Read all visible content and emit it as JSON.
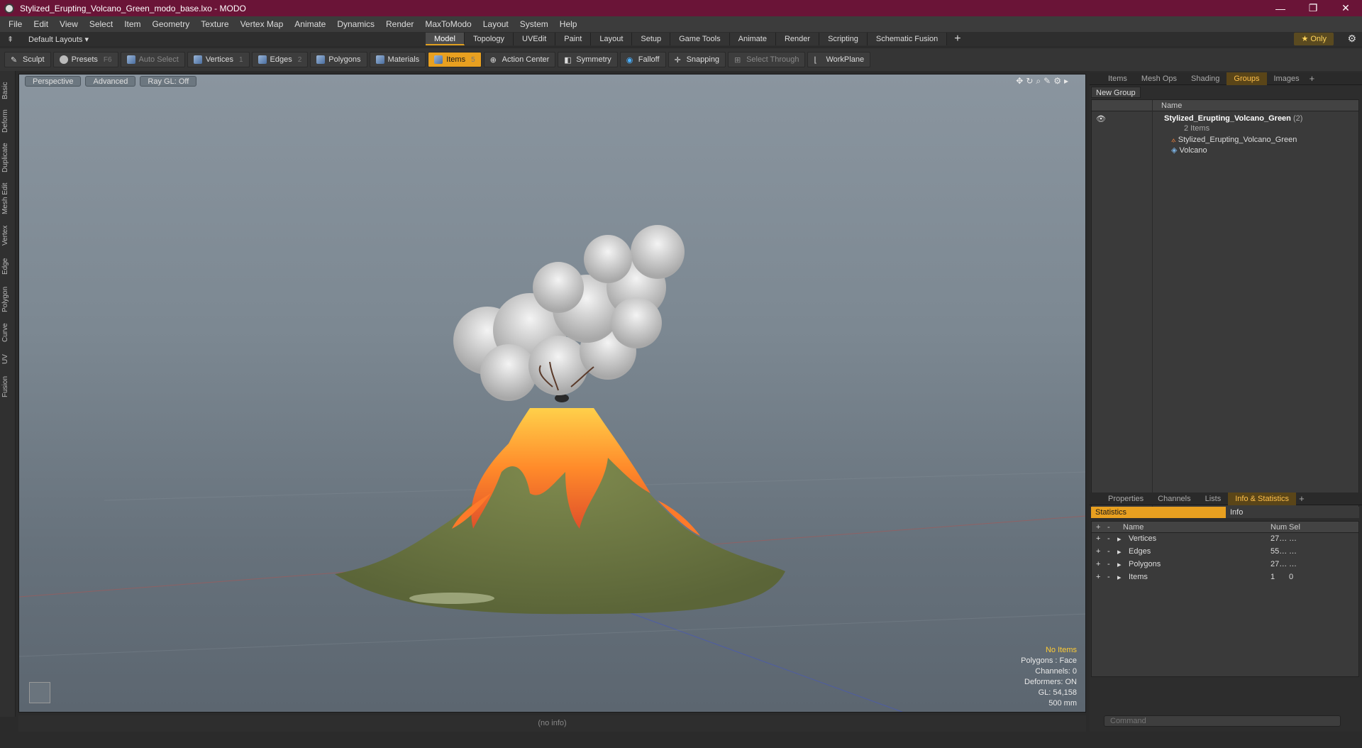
{
  "window": {
    "title": "Stylized_Erupting_Volcano_Green_modo_base.lxo - MODO",
    "minimize": "—",
    "restore": "❐",
    "close": "✕"
  },
  "menu": [
    "File",
    "Edit",
    "View",
    "Select",
    "Item",
    "Geometry",
    "Texture",
    "Vertex Map",
    "Animate",
    "Dynamics",
    "Render",
    "MaxToModo",
    "Layout",
    "System",
    "Help"
  ],
  "layouts": {
    "label": "Default Layouts ▾"
  },
  "tabs": [
    "Model",
    "Topology",
    "UVEdit",
    "Paint",
    "Layout",
    "Setup",
    "Game Tools",
    "Animate",
    "Render",
    "Scripting",
    "Schematic Fusion"
  ],
  "active_tab": "Model",
  "only_label": "Only",
  "toolbar": {
    "sculpt": "Sculpt",
    "presets": "Presets",
    "presets_key": "F6",
    "auto_select": "Auto Select",
    "vertices": "Vertices",
    "vertices_key": "1",
    "edges": "Edges",
    "edges_key": "2",
    "polygons": "Polygons",
    "materials": "Materials",
    "items": "Items",
    "items_key": "5",
    "action_center": "Action Center",
    "symmetry": "Symmetry",
    "falloff": "Falloff",
    "snapping": "Snapping",
    "select_through": "Select Through",
    "workplane": "WorkPlane"
  },
  "left_tabs": [
    "Basic",
    "Deform",
    "Duplicate",
    "Mesh Edit",
    "Vertex",
    "Edge",
    "Polygon",
    "Curve",
    "UV",
    "Fusion"
  ],
  "viewport": {
    "perspective": "Perspective",
    "advanced": "Advanced",
    "raygl": "Ray GL: Off",
    "overlay": {
      "no_items": "No Items",
      "polygons": "Polygons : Face",
      "channels": "Channels: 0",
      "deformers": "Deformers: ON",
      "gl": "GL: 54,158",
      "scale": "500 mm"
    }
  },
  "status": "(no info)",
  "right_top_tabs": [
    "Items",
    "Mesh Ops",
    "Shading",
    "Groups",
    "Images"
  ],
  "right_top_active": "Groups",
  "groups": {
    "new_group": "New Group",
    "name_header": "Name",
    "root": "Stylized_Erupting_Volcano_Green",
    "root_count": "(2)",
    "root_sub": "2 Items",
    "children": [
      "Stylized_Erupting_Volcano_Green",
      "Volcano"
    ]
  },
  "right_bottom_tabs": [
    "Properties",
    "Channels",
    "Lists",
    "Info & Statistics"
  ],
  "right_bottom_active": "Info & Statistics",
  "stats": {
    "tab_statistics": "Statistics",
    "tab_info": "Info",
    "headers": {
      "name": "Name",
      "num": "Num",
      "sel": "Sel"
    },
    "rows": [
      {
        "name": "Vertices",
        "num": "27…",
        "sel": "…"
      },
      {
        "name": "Edges",
        "num": "55…",
        "sel": "…"
      },
      {
        "name": "Polygons",
        "num": "27…",
        "sel": "…"
      },
      {
        "name": "Items",
        "num": "1",
        "sel": "0"
      }
    ]
  },
  "command": {
    "placeholder": "Command"
  }
}
